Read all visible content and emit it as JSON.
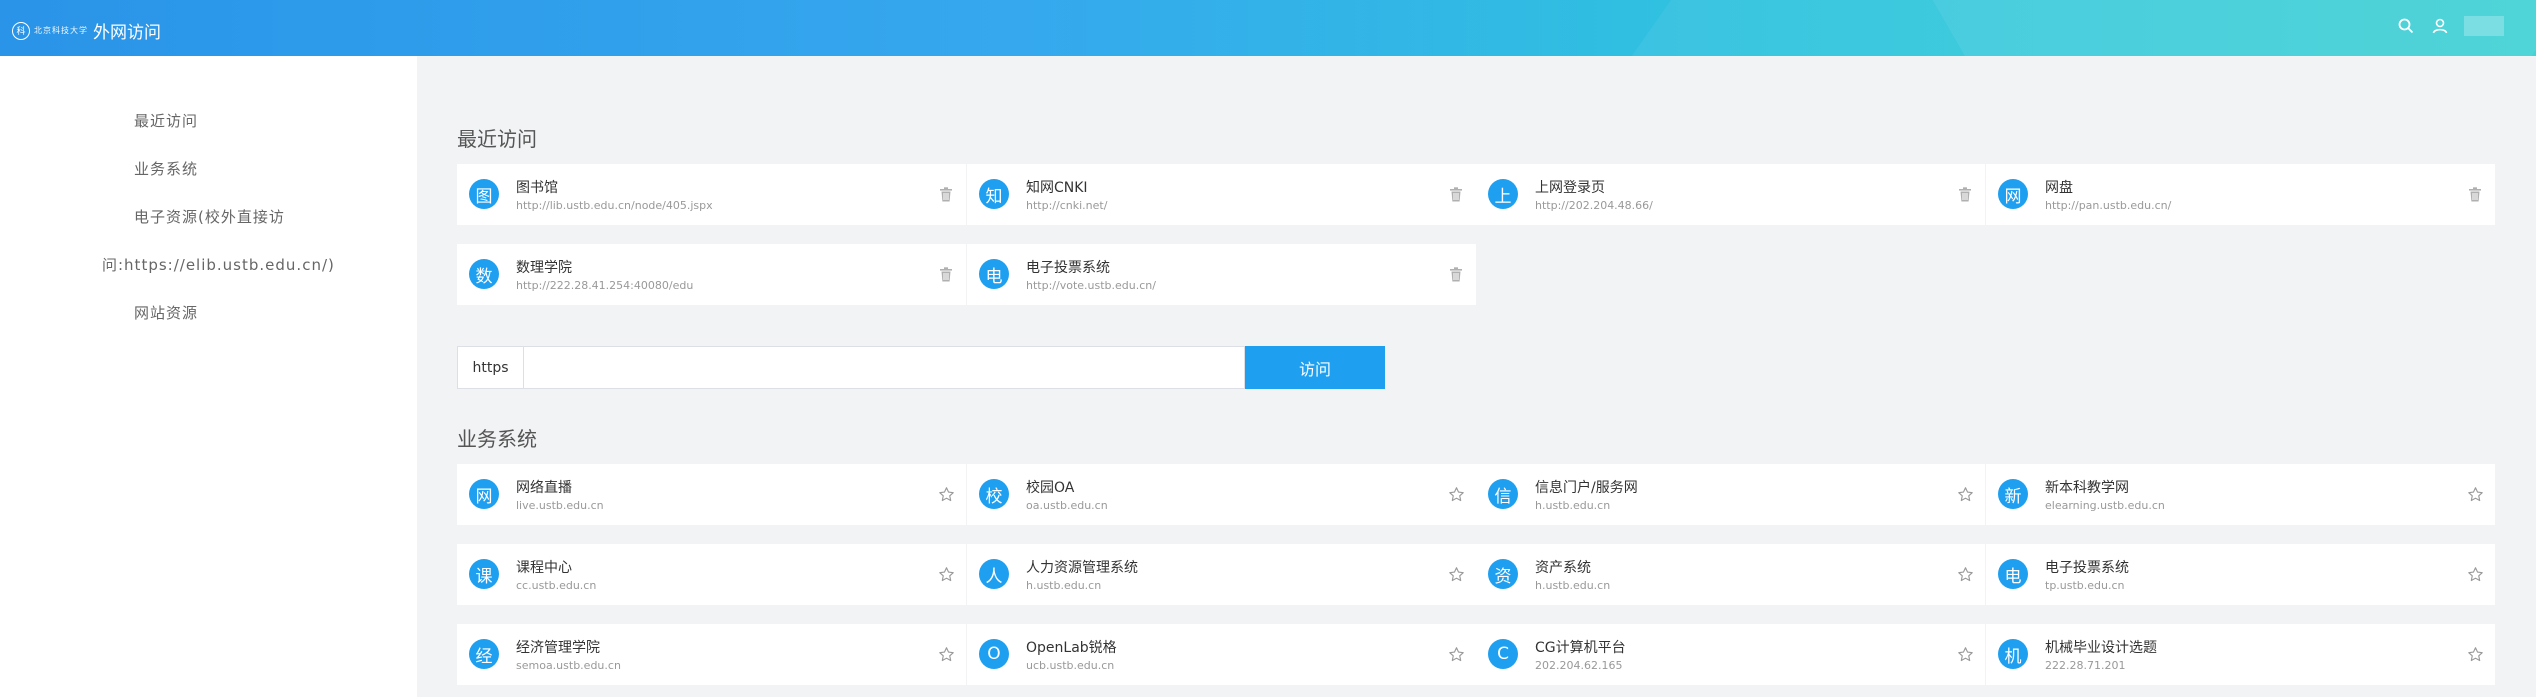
{
  "header": {
    "logo_seal": "科",
    "logo_text": "北京科技大学",
    "title": "外网访问"
  },
  "sidebar": {
    "items": [
      {
        "label": "最近访问"
      },
      {
        "label": "业务系统"
      },
      {
        "label": "电子资源(校外直接访"
      },
      {
        "label": "问:https://elib.ustb.edu.cn/)"
      },
      {
        "label": "网站资源"
      }
    ]
  },
  "recent": {
    "title": "最近访问",
    "items": [
      {
        "badge": "图",
        "name": "图书馆",
        "url": "http://lib.ustb.edu.cn/node/405.jspx"
      },
      {
        "badge": "知",
        "name": "知网CNKI",
        "url": "http://cnki.net/"
      },
      {
        "badge": "上",
        "name": "上网登录页",
        "url": "http://202.204.48.66/"
      },
      {
        "badge": "网",
        "name": "网盘",
        "url": "http://pan.ustb.edu.cn/"
      },
      {
        "badge": "数",
        "name": "数理学院",
        "url": "http://222.28.41.254:40080/edu"
      },
      {
        "badge": "电",
        "name": "电子投票系统",
        "url": "http://vote.ustb.edu.cn/"
      }
    ]
  },
  "visit": {
    "protocol": "https",
    "input_value": "",
    "button_label": "访问"
  },
  "business": {
    "title": "业务系统",
    "items": [
      {
        "badge": "网",
        "name": "网络直播",
        "url": "live.ustb.edu.cn"
      },
      {
        "badge": "校",
        "name": "校园OA",
        "url": "oa.ustb.edu.cn"
      },
      {
        "badge": "信",
        "name": "信息门户/服务网",
        "url": "h.ustb.edu.cn"
      },
      {
        "badge": "新",
        "name": "新本科教学网",
        "url": "elearning.ustb.edu.cn"
      },
      {
        "badge": "课",
        "name": "课程中心",
        "url": "cc.ustb.edu.cn"
      },
      {
        "badge": "人",
        "name": "人力资源管理系统",
        "url": "h.ustb.edu.cn"
      },
      {
        "badge": "资",
        "name": "资产系统",
        "url": "h.ustb.edu.cn"
      },
      {
        "badge": "电",
        "name": "电子投票系统",
        "url": "tp.ustb.edu.cn"
      },
      {
        "badge": "经",
        "name": "经济管理学院",
        "url": "semoa.ustb.edu.cn"
      },
      {
        "badge": "O",
        "name": "OpenLab锐格",
        "url": "ucb.ustb.edu.cn"
      },
      {
        "badge": "C",
        "name": "CG计算机平台",
        "url": "202.204.62.165"
      },
      {
        "badge": "机",
        "name": "机械毕业设计选题",
        "url": "222.28.71.201"
      }
    ]
  }
}
